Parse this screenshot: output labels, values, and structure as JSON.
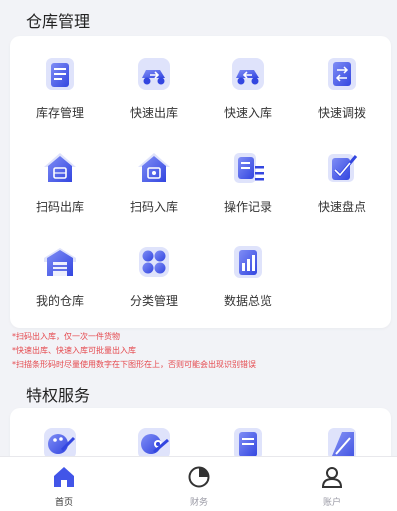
{
  "warehouse": {
    "title": "仓库管理",
    "items": [
      {
        "label": "库存管理",
        "icon": "inventory-doc-icon"
      },
      {
        "label": "快速出库",
        "icon": "truck-out-icon"
      },
      {
        "label": "快速入库",
        "icon": "truck-in-icon"
      },
      {
        "label": "快速调拨",
        "icon": "transfer-icon"
      },
      {
        "label": "扫码出库",
        "icon": "scan-house-out-icon"
      },
      {
        "label": "扫码入库",
        "icon": "scan-house-in-icon"
      },
      {
        "label": "操作记录",
        "icon": "records-icon"
      },
      {
        "label": "快速盘点",
        "icon": "stocktake-icon"
      },
      {
        "label": "我的仓库",
        "icon": "warehouse-icon"
      },
      {
        "label": "分类管理",
        "icon": "category-icon"
      },
      {
        "label": "数据总览",
        "icon": "data-chart-icon"
      }
    ],
    "notes": [
      "*扫码出入库，仅一次一件货物",
      "*快速出库、快速入库可批量出入库",
      "*扫描条形码时尽量使用数字在下图形在上，否则可能会出现识别错误"
    ]
  },
  "privileges": {
    "title": "特权服务",
    "icons": [
      "palette-icon",
      "gear-palette-icon",
      "document-icon",
      "edit-icon"
    ]
  },
  "tabbar": {
    "items": [
      {
        "label": "首页",
        "icon": "home-icon",
        "active": true
      },
      {
        "label": "财务",
        "icon": "finance-pie-icon",
        "active": false
      },
      {
        "label": "账户",
        "icon": "account-user-icon",
        "active": false
      }
    ]
  },
  "colors": {
    "accent": "#4255e8",
    "icon_light": "#dfe3fb",
    "note_red": "#e5484d"
  }
}
